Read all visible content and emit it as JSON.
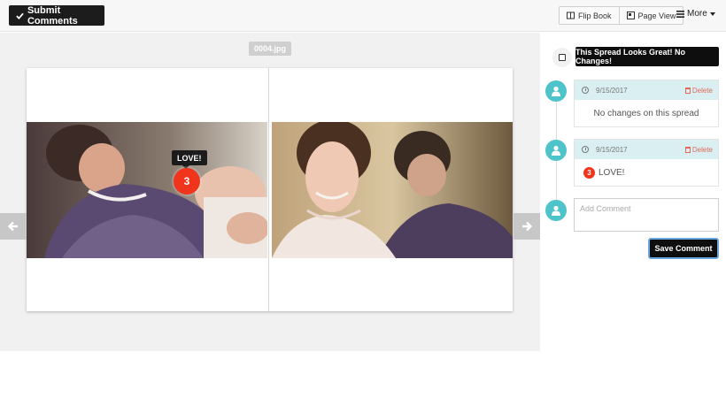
{
  "toolbar": {
    "submit_label": "Submit Comments",
    "flipbook_label": "Flip Book",
    "pageview_label": "Page View",
    "more_label": "More"
  },
  "viewer": {
    "filename": "0004.jpg",
    "tooltip": "LOVE!",
    "pin_number": "3"
  },
  "sidebar": {
    "approve_label": "This Spread Looks Great! No Changes!",
    "delete_label": "Delete",
    "comments": [
      {
        "date": "9/15/2017",
        "text": "No changes on this spread"
      },
      {
        "date": "9/15/2017",
        "pin": "3",
        "text": "LOVE!"
      }
    ],
    "add_placeholder": "Add Comment",
    "save_label": "Save Comment"
  },
  "colors": {
    "accent_teal": "#4ec3c9",
    "comment_header": "#d9eff1",
    "pin_red": "#f0351c",
    "delete_red": "#e06a5a",
    "dark_button": "#0e0e0e"
  }
}
